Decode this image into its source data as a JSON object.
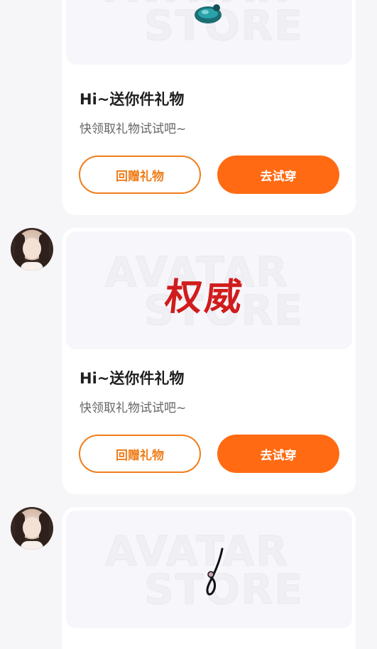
{
  "theme": {
    "accent": "#ff6a12",
    "outline": "#f07d1a",
    "background": "#f6f6f8"
  },
  "watermark": {
    "line1": "AVATAR",
    "line2": "STORE"
  },
  "messages": [
    {
      "has_avatar": false,
      "gift_item_icon": "teal-ornament-icon",
      "title": "Hi~送你件礼物",
      "subtitle": "快领取礼物试试吧~",
      "return_gift_label": "回赠礼物",
      "try_on_label": "去试穿"
    },
    {
      "has_avatar": true,
      "gift_item_text": "权威",
      "title": "Hi~送你件礼物",
      "subtitle": "快领取礼物试试吧~",
      "return_gift_label": "回赠礼物",
      "try_on_label": "去试穿"
    },
    {
      "has_avatar": true,
      "gift_item_icon": "hairpin-icon",
      "title": "",
      "subtitle": "",
      "return_gift_label": "",
      "try_on_label": ""
    }
  ]
}
